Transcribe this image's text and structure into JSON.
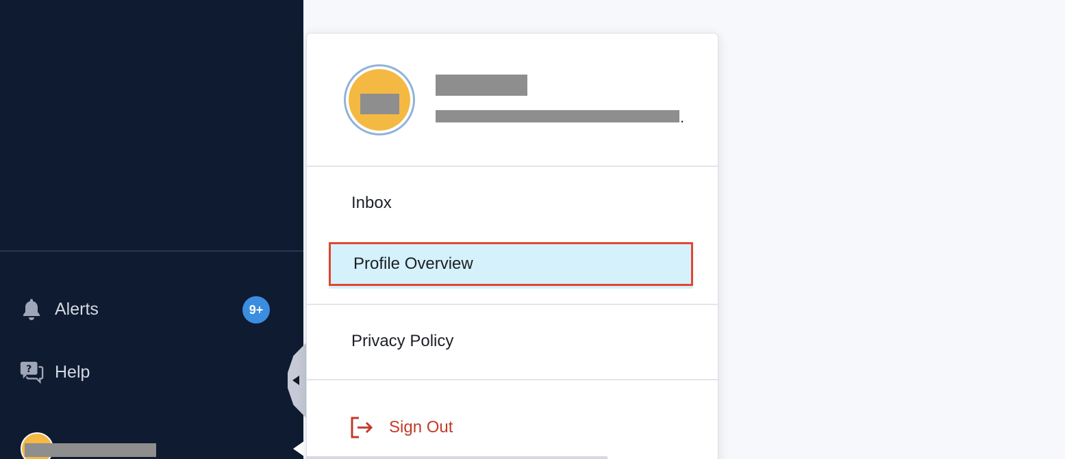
{
  "sidebar": {
    "alerts": {
      "label": "Alerts",
      "icon": "bell-icon",
      "badge": "9+"
    },
    "help": {
      "label": "Help",
      "icon": "help-chat-icon"
    }
  },
  "popover": {
    "menu": {
      "inbox": "Inbox",
      "profile_overview": "Profile Overview",
      "privacy_policy": "Privacy Policy",
      "sign_out": "Sign Out"
    }
  },
  "colors": {
    "sidebar_bg": "#0f1b31",
    "badge": "#3b8de0",
    "avatar": "#f4b942",
    "highlight_bg": "#d5f1fb",
    "highlight_border": "#e0462f",
    "sign_out": "#c23a2a"
  }
}
